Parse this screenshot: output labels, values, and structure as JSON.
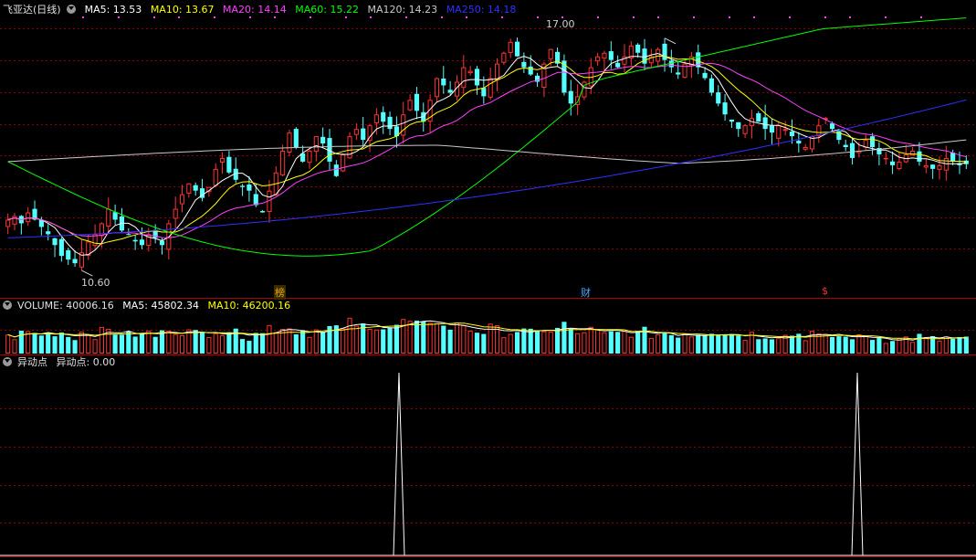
{
  "price_panel": {
    "stock_title": "飞亚达(日线)",
    "indicators": [
      {
        "label": "MA5: 13.53",
        "color": "#ffffff"
      },
      {
        "label": "MA10: 13.67",
        "color": "#ffff00"
      },
      {
        "label": "MA20: 14.14",
        "color": "#ff40ff"
      },
      {
        "label": "MA60: 15.22",
        "color": "#00ff00"
      },
      {
        "label": "MA120: 14.23",
        "color": "#c8c8c8"
      },
      {
        "label": "MA250: 14.18",
        "color": "#3030ff"
      }
    ],
    "high_label": "17.00",
    "low_label": "10.60",
    "event_marks": [
      {
        "text": "榜",
        "color": "#e6a800"
      },
      {
        "text": "财",
        "color": "#4aa8ff"
      },
      {
        "text": "$",
        "color": "#ff3030"
      }
    ]
  },
  "volume_panel": {
    "title": "VOLUME: 40006.16",
    "ma5": "MA5: 45802.34",
    "ma10": "MA10: 46200.16"
  },
  "signal_panel": {
    "name": "异动点",
    "value_label": "异动点: 0.00"
  },
  "colors": {
    "up": "#ff3232",
    "down": "#54ffff",
    "grid": "#8b0000",
    "ma5": "#ffffff",
    "ma10": "#ffff00",
    "ma20": "#ff40ff",
    "ma60": "#00ff00",
    "ma120": "#c8c8c8",
    "ma250": "#3030ff"
  },
  "chart_data": {
    "type": "candlestick",
    "title": "飞亚达(日线)",
    "price_ylim": [
      10.3,
      17.6
    ],
    "high": 17.0,
    "low": 10.6,
    "close_series_approx": [
      12.0,
      12.1,
      11.9,
      12.2,
      12.0,
      11.8,
      11.6,
      11.3,
      11.0,
      10.9,
      10.8,
      11.1,
      11.4,
      11.6,
      11.9,
      12.3,
      12.0,
      11.7,
      11.6,
      11.4,
      11.3,
      11.6,
      11.5,
      11.3,
      11.9,
      12.3,
      12.7,
      13.0,
      12.8,
      12.6,
      12.9,
      13.4,
      13.7,
      13.3,
      13.1,
      12.9,
      12.8,
      12.4,
      12.2,
      12.8,
      13.3,
      13.9,
      14.4,
      14.0,
      13.6,
      13.9,
      14.3,
      14.1,
      13.6,
      13.2,
      13.8,
      14.3,
      14.5,
      14.2,
      14.6,
      14.9,
      14.7,
      14.5,
      14.3,
      14.9,
      15.3,
      15.0,
      14.7,
      15.3,
      15.9,
      15.7,
      15.5,
      15.8,
      16.2,
      16.1,
      15.7,
      15.4,
      15.9,
      16.3,
      16.6,
      16.9,
      16.5,
      16.2,
      16.0,
      15.8,
      16.3,
      16.7,
      16.3,
      15.5,
      15.2,
      15.4,
      15.8,
      16.2,
      16.5,
      16.6,
      16.4,
      16.2,
      16.5,
      16.8,
      16.6,
      16.3,
      16.5,
      16.7,
      16.4,
      16.2,
      16.0,
      16.3,
      16.5,
      16.2,
      15.9,
      15.5,
      15.2,
      14.9,
      14.7,
      14.5,
      14.6,
      14.8,
      14.7,
      14.5,
      14.4,
      14.6,
      14.5,
      14.3,
      14.1,
      14.0,
      14.3,
      14.6,
      14.8,
      14.5,
      14.2,
      14.0,
      13.7,
      13.9,
      14.2,
      14.0,
      13.8,
      13.7,
      13.5,
      13.6,
      13.8,
      13.9,
      13.6,
      13.5,
      13.4,
      13.5,
      13.7,
      13.6,
      13.5,
      13.53
    ],
    "volume": {
      "latest": 40006.16,
      "ma5": 45802.34,
      "ma10": 46200.16
    },
    "signal": {
      "name": "异动点",
      "latest": 0.0,
      "spike_indices": [
        62,
        133
      ]
    }
  }
}
